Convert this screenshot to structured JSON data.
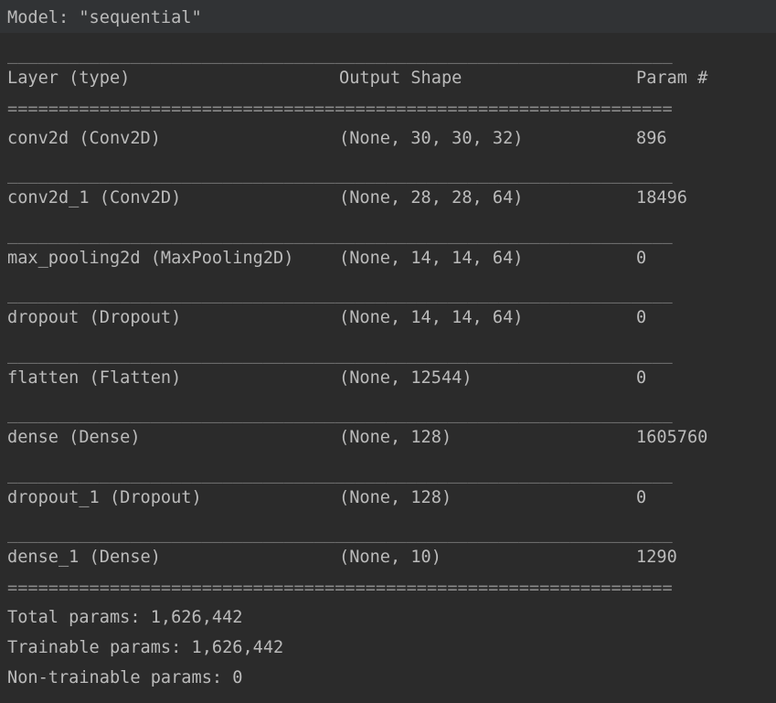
{
  "model_title": "Model: \"sequential\"",
  "separators": {
    "dash": "_________________________________________________________________",
    "double": "================================================================="
  },
  "header": {
    "layer": "Layer (type)",
    "output_shape": "Output Shape",
    "params": "Param #"
  },
  "rows": [
    {
      "layer": "conv2d (Conv2D)",
      "shape": "(None, 30, 30, 32)",
      "params": "896"
    },
    {
      "layer": "conv2d_1 (Conv2D)",
      "shape": "(None, 28, 28, 64)",
      "params": "18496"
    },
    {
      "layer": "max_pooling2d (MaxPooling2D)",
      "shape": "(None, 14, 14, 64)",
      "params": "0"
    },
    {
      "layer": "dropout (Dropout)",
      "shape": "(None, 14, 14, 64)",
      "params": "0"
    },
    {
      "layer": "flatten (Flatten)",
      "shape": "(None, 12544)",
      "params": "0"
    },
    {
      "layer": "dense (Dense)",
      "shape": "(None, 128)",
      "params": "1605760"
    },
    {
      "layer": "dropout_1 (Dropout)",
      "shape": "(None, 128)",
      "params": "0"
    },
    {
      "layer": "dense_1 (Dense)",
      "shape": "(None, 10)",
      "params": "1290"
    }
  ],
  "totals": {
    "total": "Total params: 1,626,442",
    "trainable": "Trainable params: 1,626,442",
    "non_trainable": "Non-trainable params: 0"
  }
}
